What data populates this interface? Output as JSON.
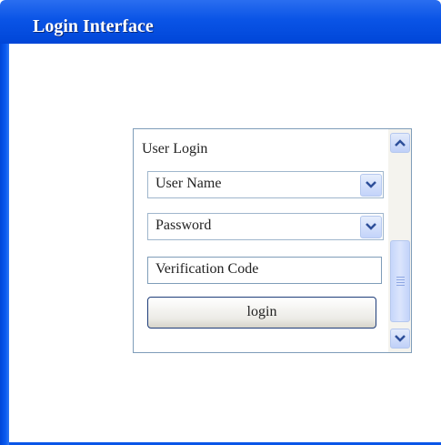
{
  "window": {
    "title": "Login Interface"
  },
  "login_panel": {
    "title": "User Login",
    "username_select": {
      "value": "User Name",
      "icon": "chevron-down-icon"
    },
    "password_select": {
      "value": "Password",
      "icon": "chevron-down-icon"
    },
    "verification_field": {
      "value": "Verification Code"
    },
    "login_button": {
      "label": "login"
    }
  },
  "scrollbar": {
    "up_icon": "chevron-up-icon",
    "down_icon": "chevron-down-icon"
  },
  "colors": {
    "titlebar": "#0a54e6",
    "panel_border": "#7f9db9",
    "button_border": "#1f3e7a"
  }
}
